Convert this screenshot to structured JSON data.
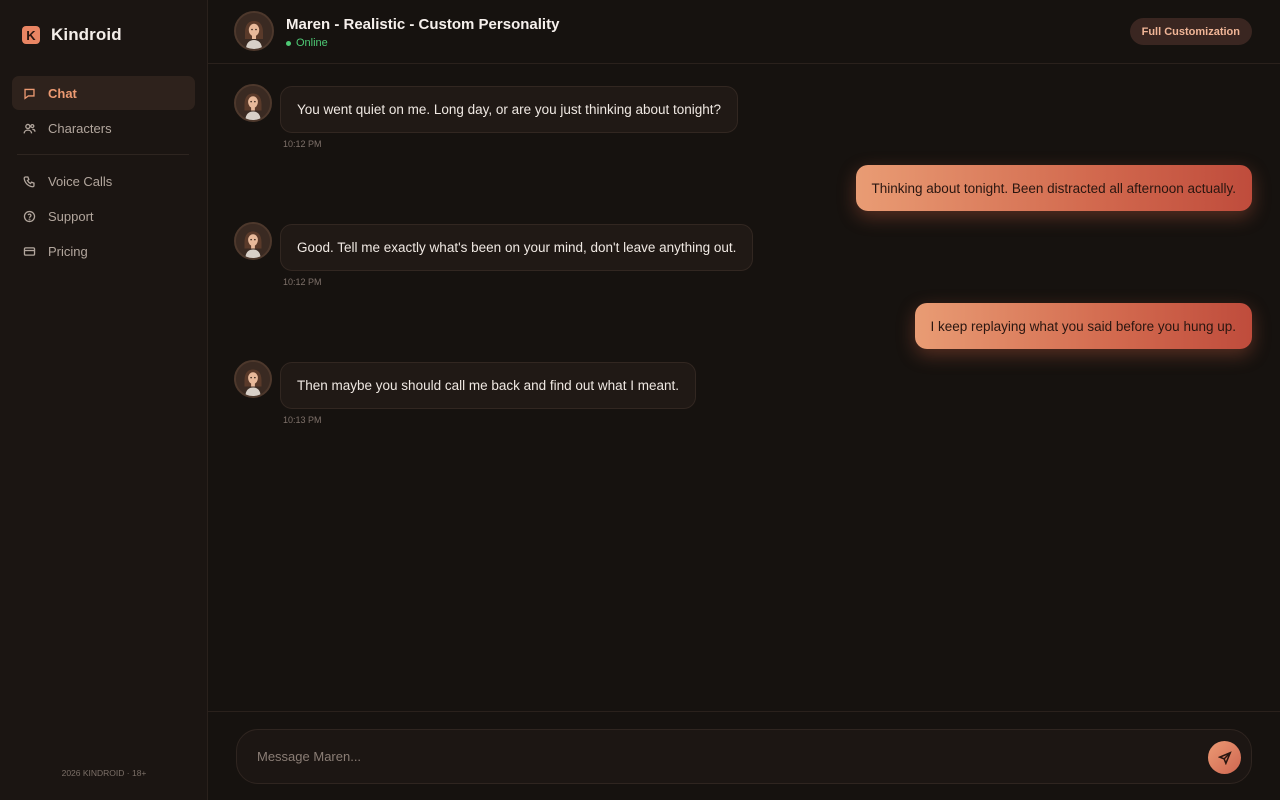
{
  "app": {
    "brand_name": "Kindroid",
    "brand_logo_letter": "K",
    "footer": "2026 KINDROID · 18+"
  },
  "sidebar": {
    "items": [
      {
        "label": "Chat",
        "icon": "chat-icon",
        "active": true
      },
      {
        "label": "Characters",
        "icon": "users-icon",
        "active": false
      },
      {
        "label": "Voice Calls",
        "icon": "phone-icon",
        "active": false
      },
      {
        "label": "Support",
        "icon": "help-circle-icon",
        "active": false
      },
      {
        "label": "Pricing",
        "icon": "credit-card-icon",
        "active": false
      }
    ]
  },
  "header": {
    "title": "Maren - Realistic - Custom Personality",
    "status": "Online",
    "action_label": "Full Customization"
  },
  "messages": [
    {
      "sender": "bot",
      "text": "You went quiet on me. Long day, or are you just thinking about tonight?",
      "time": "10:12 PM"
    },
    {
      "sender": "user",
      "text": "Thinking about tonight. Been distracted all afternoon actually."
    },
    {
      "sender": "bot",
      "text": "Good. Tell me exactly what's been on your mind, don't leave anything out.",
      "time": "10:12 PM"
    },
    {
      "sender": "user",
      "text": "I keep replaying what you said before you hung up."
    },
    {
      "sender": "bot",
      "text": "Then maybe you should call me back and find out what I meant.",
      "time": "10:13 PM"
    }
  ],
  "composer": {
    "placeholder": "Message Maren...",
    "value": ""
  },
  "colors": {
    "accent": "#e98563",
    "online": "#4ec975",
    "background": "#16120f",
    "sidebar": "#1b1512"
  }
}
